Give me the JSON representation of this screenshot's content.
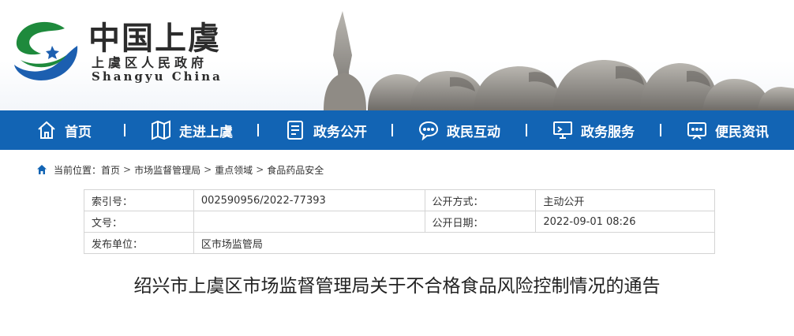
{
  "header": {
    "logo_cn": "中国上虞",
    "logo_sub": "上虞区人民政府",
    "logo_en": "Shangyu China"
  },
  "nav": {
    "items": [
      {
        "label": "首页",
        "icon": "home-icon"
      },
      {
        "label": "走进上虞",
        "icon": "map-icon"
      },
      {
        "label": "政务公开",
        "icon": "document-icon"
      },
      {
        "label": "政民互动",
        "icon": "chat-icon"
      },
      {
        "label": "政务服务",
        "icon": "monitor-icon"
      },
      {
        "label": "便民资讯",
        "icon": "info-icon"
      }
    ]
  },
  "breadcrumb": {
    "prefix": "当前位置：",
    "items": [
      "首页",
      "市场监督管理局",
      "重点领域",
      "食品药品安全"
    ],
    "separator": ">"
  },
  "meta": {
    "rows": [
      {
        "k1": "索引号：",
        "v1": "002590956/2022-77393",
        "k2": "公开方式：",
        "v2": "主动公开"
      },
      {
        "k1": "文号：",
        "v1": "",
        "k2": "公开日期：",
        "v2": "2022-09-01 08:26"
      },
      {
        "k1": "发布单位：",
        "v1": "区市场监管局"
      }
    ]
  },
  "title": "绍兴市上虞区市场监督管理局关于不合格食品风险控制情况的通告",
  "colors": {
    "nav_bg": "#1264b4",
    "logo_green": "#1e8a3c",
    "logo_blue": "#1c5fb0"
  }
}
